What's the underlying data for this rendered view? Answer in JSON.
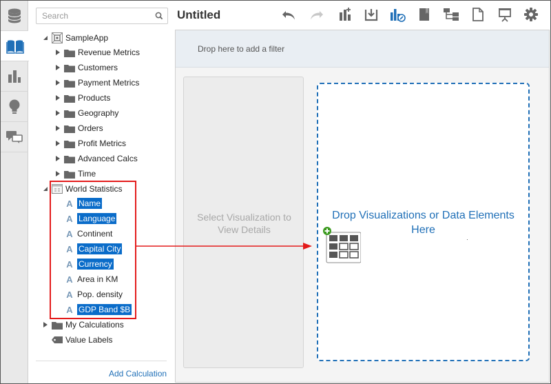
{
  "app": {
    "title": "Untitled"
  },
  "search": {
    "placeholder": "Search",
    "value": ""
  },
  "rail": {
    "items": [
      {
        "icon": "database-icon"
      },
      {
        "icon": "book-icon",
        "active": true
      },
      {
        "icon": "bar-chart-icon"
      },
      {
        "icon": "lightbulb-icon"
      },
      {
        "icon": "chat-icon"
      }
    ]
  },
  "tree": {
    "root": "SampleApp",
    "folders": [
      "Revenue Metrics",
      "Customers",
      "Payment Metrics",
      "Products",
      "Geography",
      "Orders",
      "Profit Metrics",
      "Advanced Calcs",
      "Time"
    ],
    "subject": "World Statistics",
    "attributes": [
      {
        "label": "Name",
        "selected": true
      },
      {
        "label": "Language",
        "selected": true
      },
      {
        "label": "Continent",
        "selected": false
      },
      {
        "label": "Capital City",
        "selected": true
      },
      {
        "label": "Currency",
        "selected": true
      },
      {
        "label": "Area in KM",
        "selected": false
      },
      {
        "label": "Pop. density",
        "selected": false
      },
      {
        "label": "GDP Band $B",
        "selected": true
      }
    ],
    "my_calcs": "My Calculations",
    "value_labels": "Value Labels"
  },
  "panel": {
    "add_calculation": "Add Calculation"
  },
  "canvas": {
    "filter_hint": "Drop here to add a filter",
    "details_line1": "Select Visualization to",
    "details_line2": "View Details",
    "drop_line1": "Drop Visualizations or Data Elements",
    "drop_line2": "Here"
  },
  "colors": {
    "accent": "#1f6fb7",
    "selection": "#0a6cc9",
    "highlight": "#e31a1a",
    "add": "#3c9a1f"
  },
  "toolbar_icons": [
    "undo-icon",
    "redo-icon",
    "add-visualization-icon",
    "export-icon",
    "data-action-icon",
    "bookmark-icon",
    "hierarchy-icon",
    "page-icon",
    "presentation-icon",
    "settings-icon"
  ]
}
